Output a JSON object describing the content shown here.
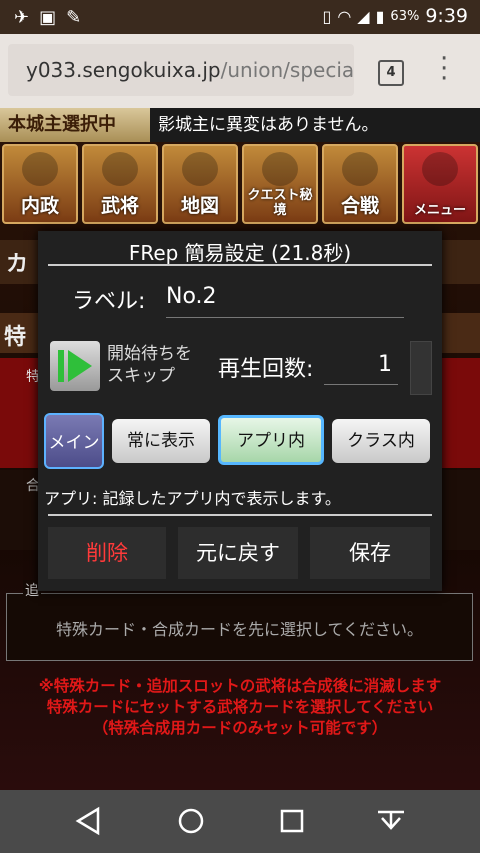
{
  "status": {
    "battery": "63%",
    "time": "9:39"
  },
  "browser": {
    "url_main": "y033.sengokuixa.jp",
    "url_path": "/union/specia",
    "tab_count": "4"
  },
  "game": {
    "ribbon_left": "本城主選択中",
    "ribbon_right": "影城主に異変はありません。",
    "menu": [
      "内政",
      "武将",
      "地図",
      "クエスト秘境",
      "合戦",
      "メニュー"
    ],
    "bg_label_1": "カ",
    "bg_label_2": "特",
    "bg_label_3": "特",
    "bg_label_4": "合",
    "select_header": "追",
    "select_text": "特殊カード・合成カードを先に選択してください。",
    "notes": [
      "※特殊カード・追加スロットの武将は合成後に消滅します",
      "特殊カードにセットする武将カードを選択してください",
      "（特殊合成用カードのみセット可能です）"
    ]
  },
  "dialog": {
    "title": "FRep 簡易設定 (21.8秒)",
    "label_caption": "ラベル:",
    "label_value": "No.2",
    "skip_line1": "開始待ちを",
    "skip_line2": "スキップ",
    "count_caption": "再生回数:",
    "count_value": "1",
    "segments": [
      "メイン",
      "常に表示",
      "アプリ内",
      "クラス内"
    ],
    "description": "アプリ: 記録したアプリ内で表示します。",
    "delete": "削除",
    "revert": "元に戻す",
    "save": "保存"
  }
}
